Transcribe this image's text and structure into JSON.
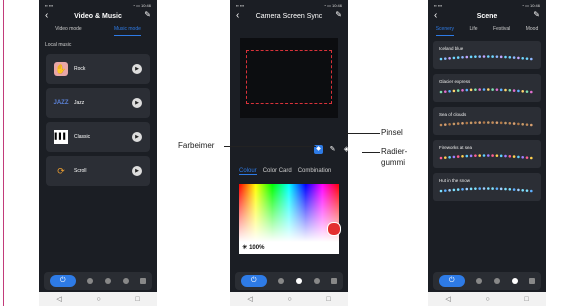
{
  "phone1": {
    "title": "Video & Music",
    "tabs": [
      "Video mode",
      "Music mode"
    ],
    "active_tab": 1,
    "section": "Local music",
    "songs": [
      {
        "label": "Rock",
        "icon": "hand-icon"
      },
      {
        "label": "Jazz",
        "icon": "jazz-icon"
      },
      {
        "label": "Classic",
        "icon": "piano-icon"
      },
      {
        "label": "Scroll",
        "icon": "scroll-icon"
      }
    ]
  },
  "phone2": {
    "title": "Camera Screen Sync",
    "colour_tabs": [
      "Colour",
      "Color Card",
      "Combination"
    ],
    "brightness": "100%"
  },
  "phone3": {
    "title": "Scene",
    "tabs": [
      "Scenery",
      "Life",
      "Festival",
      "Mood"
    ],
    "scenes": [
      "Iceland blue",
      "Glacier express",
      "Sea of clouds",
      "Fireworks at sea",
      "Hut in the snow"
    ]
  },
  "callouts": {
    "left": "Farbeimer",
    "right_top": "Pinsel",
    "right_bottom_1": "Radier-",
    "right_bottom_2": "gummi"
  },
  "colors": {
    "accent": "#2e7be6",
    "background": "#1b1e24",
    "card": "#2b2e35",
    "frame": "#d9323a"
  }
}
